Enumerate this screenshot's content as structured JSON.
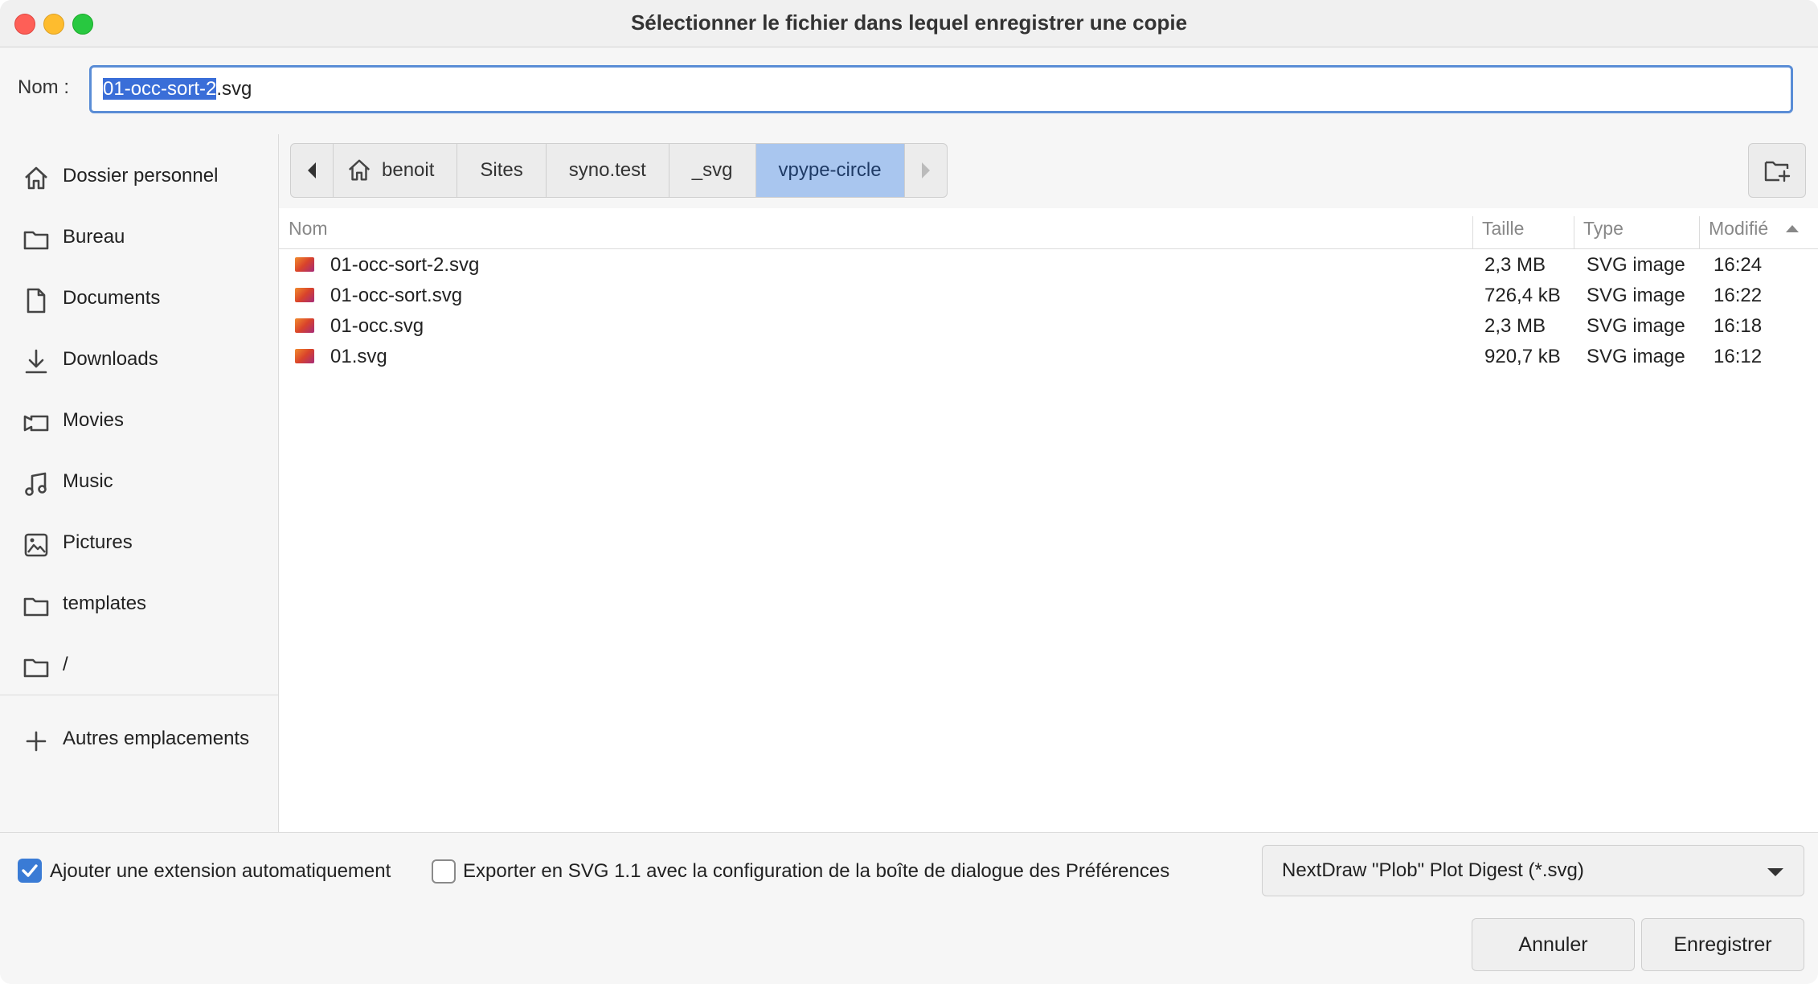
{
  "window": {
    "title": "Sélectionner le fichier dans lequel enregistrer une copie"
  },
  "name_field": {
    "label": "Nom :",
    "selected_part": "01-occ-sort-2",
    "extension": ".svg"
  },
  "sidebar": {
    "items": [
      {
        "label": "Dossier personnel",
        "icon": "home-icon"
      },
      {
        "label": "Bureau",
        "icon": "folder-icon"
      },
      {
        "label": "Documents",
        "icon": "document-icon"
      },
      {
        "label": "Downloads",
        "icon": "download-icon"
      },
      {
        "label": "Movies",
        "icon": "video-icon"
      },
      {
        "label": "Music",
        "icon": "music-icon"
      },
      {
        "label": "Pictures",
        "icon": "picture-icon"
      },
      {
        "label": "templates",
        "icon": "folder-icon"
      },
      {
        "label": "/",
        "icon": "folder-icon"
      }
    ],
    "other_locations": "Autres emplacements"
  },
  "path": {
    "crumbs": [
      "benoit",
      "Sites",
      "syno.test",
      "_svg",
      "vpype-circle"
    ],
    "active": "vpype-circle"
  },
  "columns": {
    "name": "Nom",
    "size": "Taille",
    "type": "Type",
    "modified": "Modifié"
  },
  "files": [
    {
      "name": "01-occ-sort-2.svg",
      "size": "2,3 MB",
      "type": "SVG image",
      "modified": "16:24"
    },
    {
      "name": "01-occ-sort.svg",
      "size": "726,4 kB",
      "type": "SVG image",
      "modified": "16:22"
    },
    {
      "name": "01-occ.svg",
      "size": "2,3 MB",
      "type": "SVG image",
      "modified": "16:18"
    },
    {
      "name": "01.svg",
      "size": "920,7 kB",
      "type": "SVG image",
      "modified": "16:12"
    }
  ],
  "options": {
    "auto_extension": {
      "label": "Ajouter une extension automatiquement",
      "checked": true
    },
    "export_svg11": {
      "label": "Exporter en SVG 1.1 avec la configuration de la boîte de dialogue des Préférences",
      "checked": false
    }
  },
  "filter": {
    "selected": "NextDraw \"Plob\" Plot Digest (*.svg)"
  },
  "buttons": {
    "cancel": "Annuler",
    "save": "Enregistrer"
  },
  "colors": {
    "accent": "#3a7bd5",
    "selection": "#3a6ed8",
    "active_crumb": "#a9c6ef"
  }
}
